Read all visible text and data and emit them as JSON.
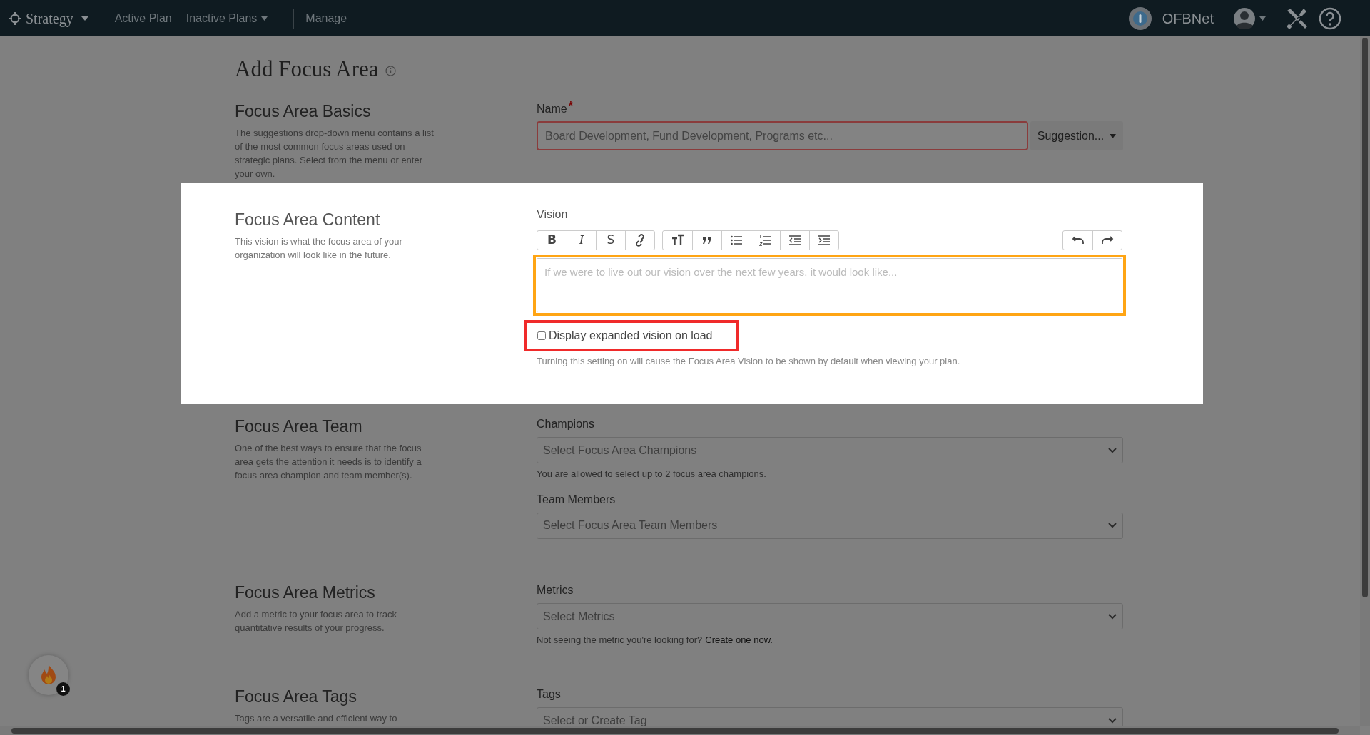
{
  "nav": {
    "brand": "Strategy",
    "links": [
      {
        "label": "Active Plan",
        "dropdown": false
      },
      {
        "label": "Inactive Plans",
        "dropdown": true
      },
      {
        "label": "Manage",
        "dropdown": false
      }
    ],
    "org": "OFBNet"
  },
  "title": "Add Focus Area",
  "basics": {
    "heading": "Focus Area Basics",
    "description": "The suggestions drop-down menu contains a list of the most common focus areas used on strategic plans. Select from the menu or enter your own.",
    "label": "Name",
    "required": true,
    "required_mark": "*",
    "placeholder": "Board Development, Fund Development, Programs etc...",
    "suggestion_button": "Suggestion..."
  },
  "content": {
    "heading": "Focus Area Content",
    "description": "This vision is what the focus area of your organization will look like in the future.",
    "label": "Vision",
    "toolbar": [
      [
        {
          "kind": "bold",
          "label": "B"
        },
        {
          "kind": "italic",
          "label": "I"
        },
        {
          "kind": "strike",
          "label": "S"
        },
        {
          "kind": "link"
        }
      ],
      [
        {
          "kind": "heading"
        },
        {
          "kind": "quote"
        },
        {
          "kind": "bullets"
        },
        {
          "kind": "numbers"
        },
        {
          "kind": "outdent"
        },
        {
          "kind": "indent"
        }
      ],
      [
        {
          "kind": "undo"
        },
        {
          "kind": "redo"
        }
      ]
    ],
    "placeholder": "If we were to live out our vision over the next few years, it would look like...",
    "checkbox": {
      "label": "Display expanded vision on load",
      "checked": false
    },
    "help": "Turning this setting on will cause the Focus Area Vision to be shown by default when viewing your plan."
  },
  "team": {
    "heading": "Focus Area Team",
    "description": "One of the best ways to ensure that the focus area gets the attention it needs is to identify a focus area champion and team member(s).",
    "fields": [
      {
        "label": "Champions",
        "placeholder": "Select Focus Area Champions",
        "help": "You are allowed to select up to 2 focus area champions."
      },
      {
        "label": "Team Members",
        "placeholder": "Select Focus Area Team Members"
      }
    ]
  },
  "metrics": {
    "heading": "Focus Area Metrics",
    "description": "Add a metric to your focus area to track quantitative results of your progress.",
    "label": "Metrics",
    "placeholder": "Select Metrics",
    "help": "Not seeing the metric you're looking for?",
    "help_link": "Create one now."
  },
  "tags": {
    "heading": "Focus Area Tags",
    "description": "Tags are a versatile and efficient way to",
    "label": "Tags",
    "placeholder": "Select or Create Tag"
  },
  "notification": {
    "count": "1"
  }
}
